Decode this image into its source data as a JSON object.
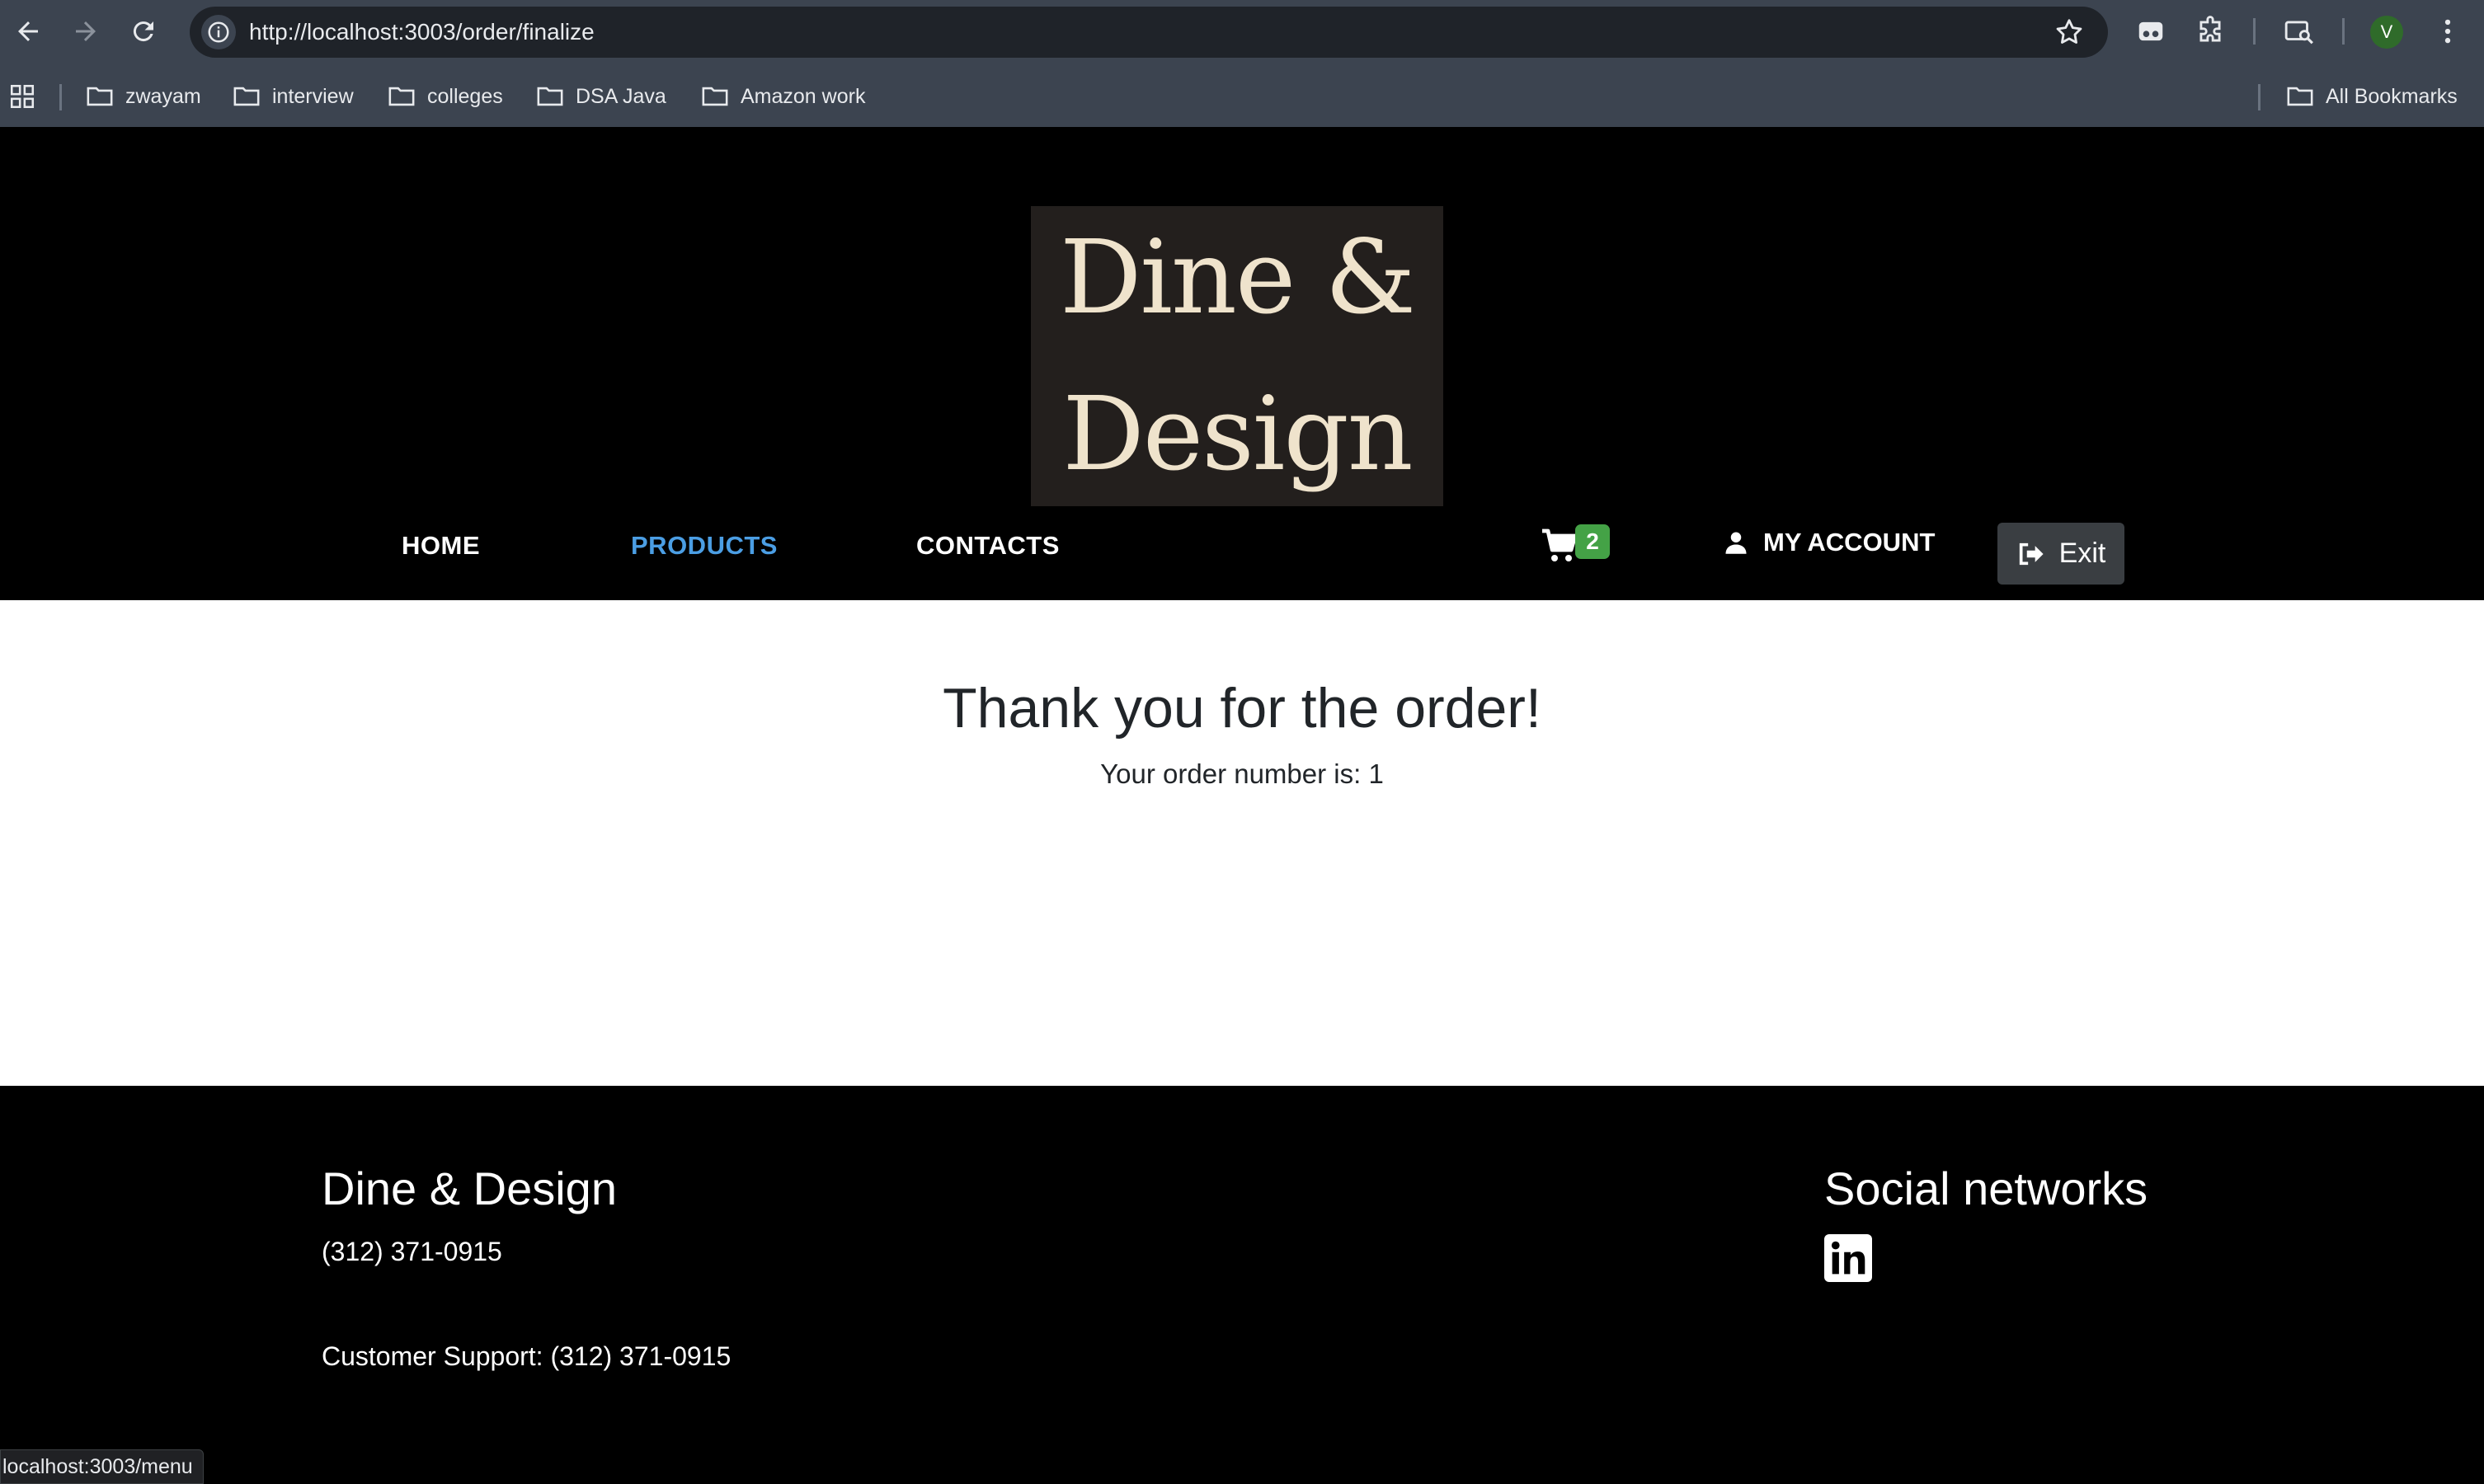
{
  "browser": {
    "url": "http://localhost:3003/order/finalize",
    "avatar_letter": "V",
    "bookmarks": [
      "zwayam",
      "interview",
      "colleges",
      "DSA Java",
      "Amazon work"
    ],
    "all_bookmarks": "All Bookmarks",
    "status_url": "localhost:3003/menu"
  },
  "header": {
    "logo_line1": "Dine &",
    "logo_line2": "Design",
    "nav": {
      "home": "HOME",
      "products": "PRODUCTS",
      "contacts": "CONTACTS"
    },
    "cart_count": "2",
    "account_label": "MY ACCOUNT",
    "exit_label": "Exit",
    "colors": {
      "active_link": "#4b9ee4",
      "badge": "#44a246"
    }
  },
  "main": {
    "heading": "Thank you for the order!",
    "order_text": "Your order number is: 1"
  },
  "footer": {
    "brand": "Dine & Design",
    "phone": "(312) 371-0915",
    "support": "Customer Support: (312) 371-0915",
    "social_title": "Social networks",
    "social_icons": [
      "linkedin-icon"
    ]
  }
}
